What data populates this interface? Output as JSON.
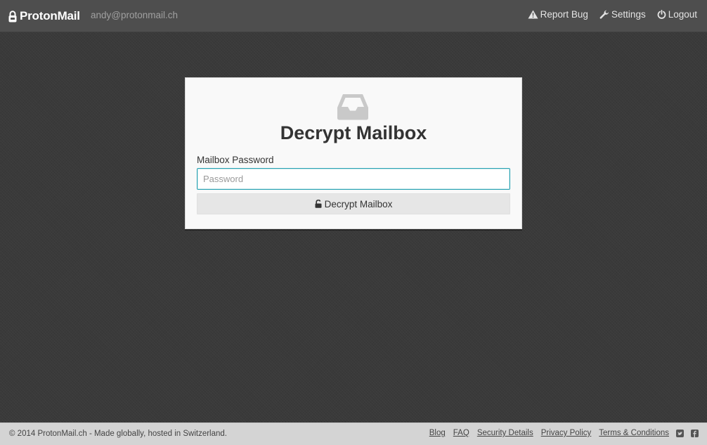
{
  "header": {
    "brand_name": "ProtonMail",
    "user_email": "andy@protonmail.ch",
    "nav": {
      "report_bug": "Report Bug",
      "settings": "Settings",
      "logout": "Logout"
    }
  },
  "card": {
    "icon": "inbox-tray-icon",
    "title": "Decrypt Mailbox",
    "field_label": "Mailbox Password",
    "password_placeholder": "Password",
    "password_value": "",
    "button_label": "Decrypt Mailbox",
    "button_icon": "unlock-icon"
  },
  "footer": {
    "copyright": "© 2014 ProtonMail.ch - Made globally, hosted in Switzerland.",
    "links": {
      "blog": "Blog",
      "faq": "FAQ",
      "security_details": "Security Details",
      "privacy_policy": "Privacy Policy",
      "terms": "Terms & Conditions"
    },
    "social_icons": [
      "twitter-icon",
      "facebook-icon"
    ]
  },
  "colors": {
    "header_bg": "#4e4e4e",
    "page_bg": "#3a3a3a",
    "card_bg": "#f9f9f9",
    "input_focus_border": "#2aa3b3",
    "button_bg": "#e6e6e6",
    "footer_bg": "#d4d4d4"
  }
}
